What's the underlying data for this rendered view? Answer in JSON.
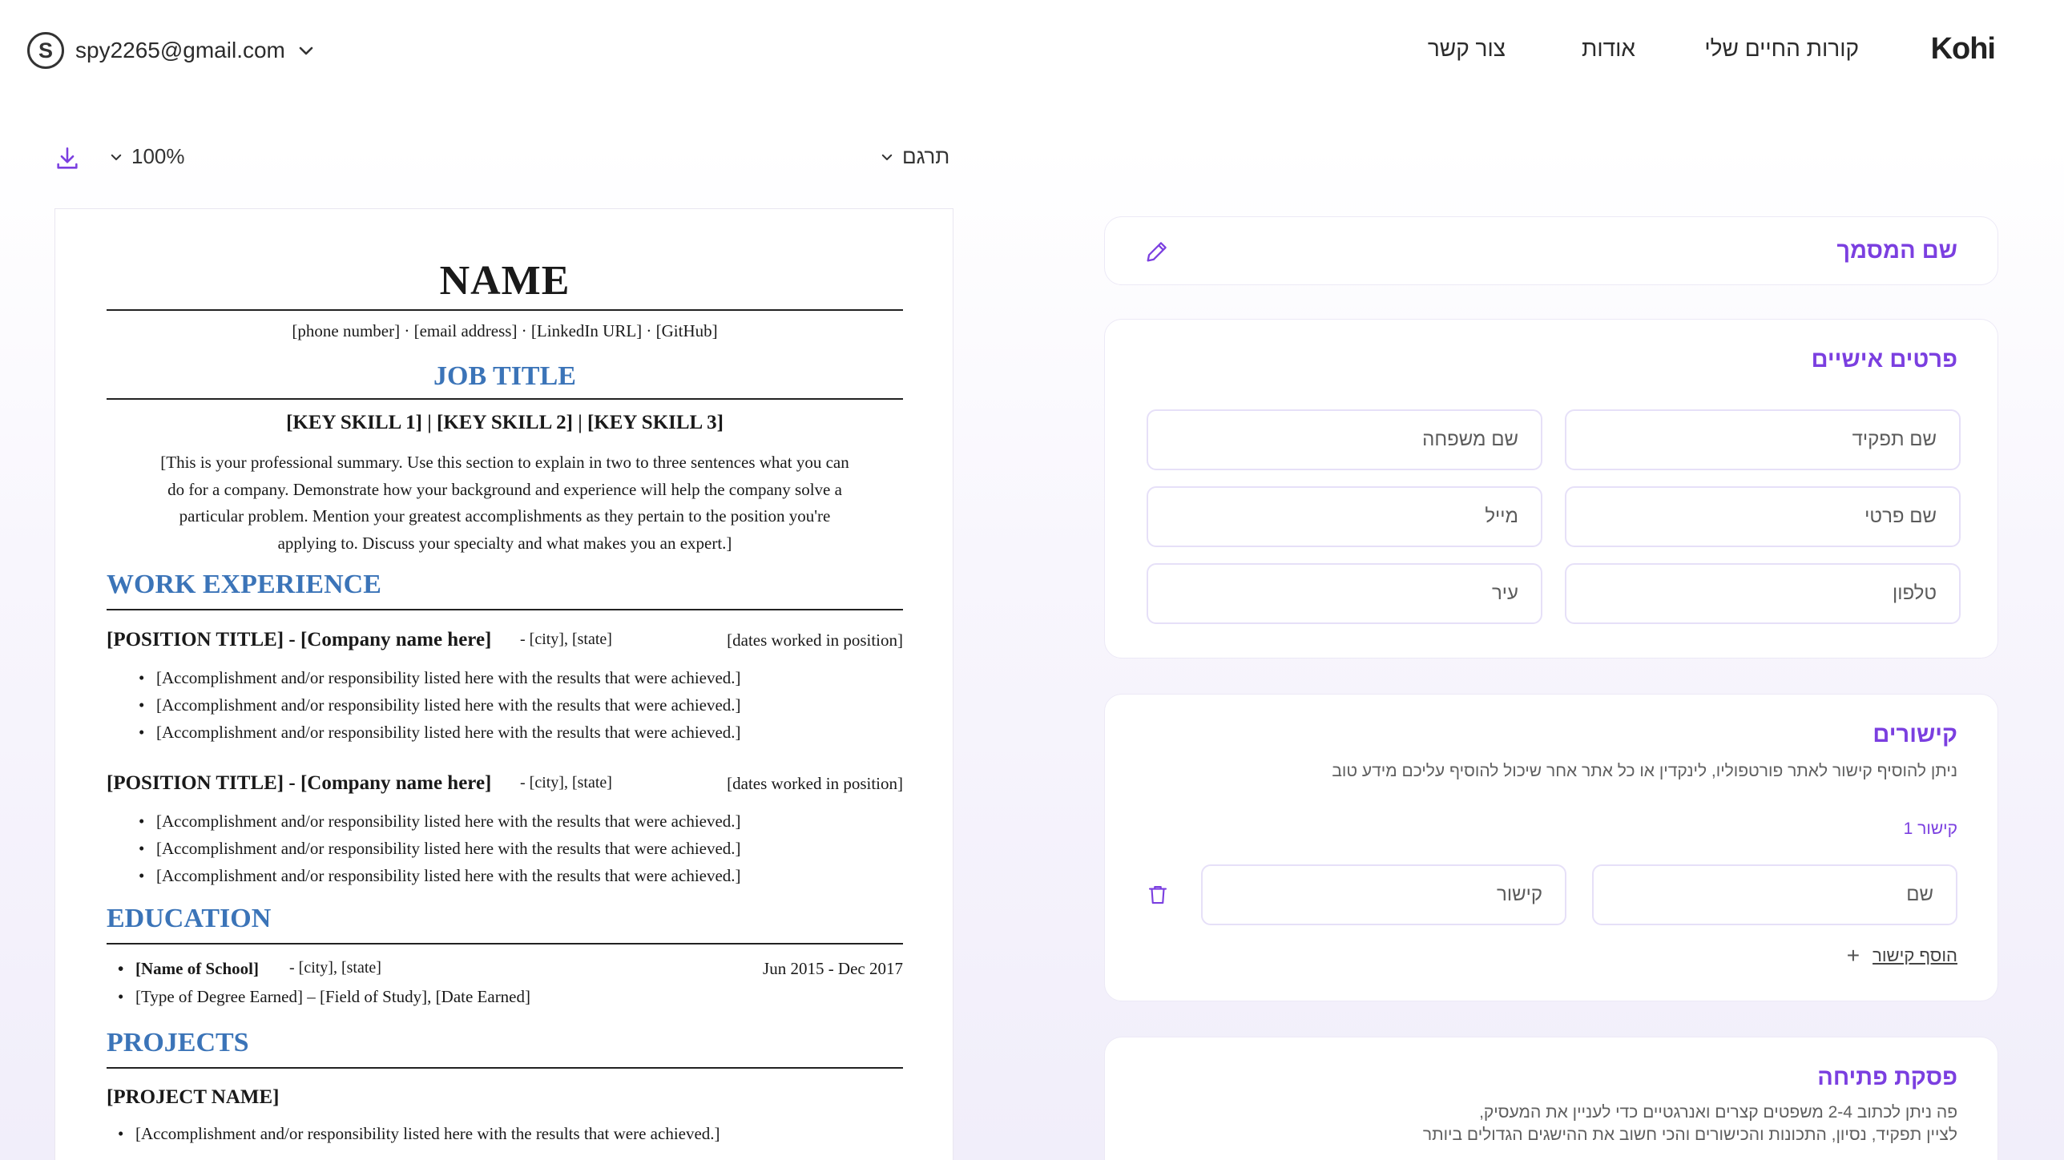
{
  "header": {
    "account": {
      "avatar_letter": "S",
      "email": "spy2265@gmail.com"
    },
    "nav": [
      {
        "label": "צור קשר"
      },
      {
        "label": "אודות"
      },
      {
        "label": "קורות החיים שלי"
      }
    ],
    "logo": "Kohi"
  },
  "toolbar": {
    "zoom": "100%",
    "translate_label": "תרגם"
  },
  "resume": {
    "name": "NAME",
    "contact": "[phone number] · [email address] · [LinkedIn URL] · [GitHub]",
    "job_title": "JOB TITLE",
    "skills": "[KEY SKILL 1] | [KEY SKILL 2] | [KEY SKILL 3]",
    "summary_lines": [
      "[This is your professional summary. Use this section to explain in two to three sentences what you can",
      "do for a company. Demonstrate how your background and experience will help the company solve a",
      "particular problem. Mention your greatest accomplishments as they pertain to the position you're",
      "applying to. Discuss your specialty and what makes you an expert.]"
    ],
    "work_heading": "WORK EXPERIENCE",
    "positions": [
      {
        "title": "[POSITION TITLE] - [Company name here]",
        "location": "- [city], [state]",
        "dates": "[dates worked in position]",
        "bullets": [
          "[Accomplishment and/or responsibility listed here with the results that were achieved.]",
          "[Accomplishment and/or responsibility listed here with the results that were achieved.]",
          "[Accomplishment and/or responsibility listed here with the results that were achieved.]"
        ]
      },
      {
        "title": "[POSITION TITLE] - [Company name here]",
        "location": "- [city], [state]",
        "dates": "[dates worked in position]",
        "bullets": [
          "[Accomplishment and/or responsibility listed here with the results that were achieved.]",
          "[Accomplishment and/or responsibility listed here with the results that were achieved.]",
          "[Accomplishment and/or responsibility listed here with the results that were achieved.]"
        ]
      }
    ],
    "education_heading": "EDUCATION",
    "education": {
      "school": "[Name of School]",
      "location": "- [city], [state]",
      "dates": "Jun 2015 - Dec 2017",
      "degree": "[Type of Degree Earned] – [Field of Study], [Date Earned]"
    },
    "projects_heading": "PROJECTS",
    "project_name": "[PROJECT NAME]",
    "project_bullet": "[Accomplishment and/or responsibility listed here with the results that were achieved.]"
  },
  "form": {
    "doc_name_label": "שם המסמך",
    "personal": {
      "title": "פרטים אישיים",
      "fields": {
        "job_title": "שם תפקיד",
        "last_name": "שם משפחה",
        "first_name": "שם פרטי",
        "email": "מייל",
        "phone": "טלפון",
        "city": "עיר"
      }
    },
    "links": {
      "title": "קישורים",
      "helper": "ניתן להוסיף קישור לאתר פורטפוליו, לינקדין או כל אתר אחר שיכול להוסיף עליכם מידע טוב",
      "link_label": "קישור 1",
      "name_placeholder": "שם",
      "url_placeholder": "קישור",
      "add_label": "הוסף קישור"
    },
    "opening": {
      "title": "פסקת פתיחה",
      "helper_lines": [
        "פה ניתן לכתוב 2-4 משפטים קצרים ואנרגטיים כדי לעניין את המעסיק,",
        "לציין תפקיד, נסיון, התכונות והכישורים והכי חשוב את ההישגים הגדולים ביותר"
      ]
    }
  },
  "colors": {
    "accent": "#7b3fe0",
    "resume_heading": "#3b74b8"
  }
}
